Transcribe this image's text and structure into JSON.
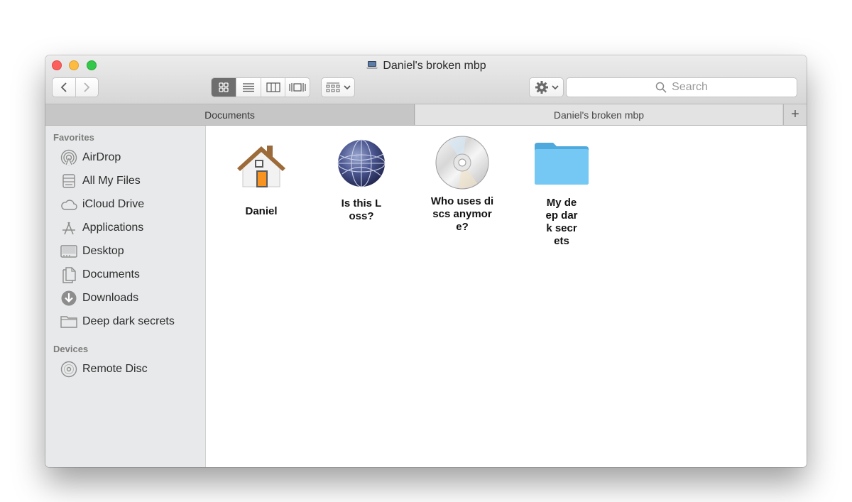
{
  "window": {
    "title": "Daniel's broken mbp",
    "title_icon": "laptop-icon"
  },
  "toolbar": {
    "back_icon": "chevron-left-icon",
    "forward_icon": "chevron-right-icon",
    "view_modes": [
      "icon-view",
      "list-view",
      "column-view",
      "cover-flow-view"
    ],
    "active_view": "icon-view",
    "arrange_icon": "arrange-grid-icon",
    "action_icon": "gear-icon",
    "search_placeholder": "Search"
  },
  "tabs": [
    {
      "label": "Documents",
      "active": true
    },
    {
      "label": "Daniel's broken mbp",
      "active": false
    }
  ],
  "tab_add_label": "+",
  "sidebar": {
    "favorites_title": "Favorites",
    "favorites": [
      {
        "label": "AirDrop",
        "icon": "airdrop-icon"
      },
      {
        "label": "All My Files",
        "icon": "all-files-icon"
      },
      {
        "label": "iCloud Drive",
        "icon": "cloud-icon"
      },
      {
        "label": "Applications",
        "icon": "applications-icon"
      },
      {
        "label": "Desktop",
        "icon": "desktop-icon"
      },
      {
        "label": "Documents",
        "icon": "documents-icon"
      },
      {
        "label": "Downloads",
        "icon": "downloads-icon"
      },
      {
        "label": "Deep dark secrets",
        "icon": "folder-icon"
      }
    ],
    "devices_title": "Devices",
    "devices": [
      {
        "label": "Remote Disc",
        "icon": "disc-icon"
      }
    ]
  },
  "files": [
    {
      "label": "Daniel",
      "icon": "home-icon"
    },
    {
      "label": "Is this Loss?",
      "icon": "network-globe-icon"
    },
    {
      "label": "Who uses discs anymore?",
      "icon": "cd-disc-icon"
    },
    {
      "label": "My deep dark secrets",
      "icon": "blue-folder-icon"
    }
  ],
  "colors": {
    "close": "#fc605c",
    "minimize": "#fdbc40",
    "maximize": "#34c84a",
    "folder_blue": "#5ec0f0",
    "sidebar_bg": "#e8e9ea"
  }
}
